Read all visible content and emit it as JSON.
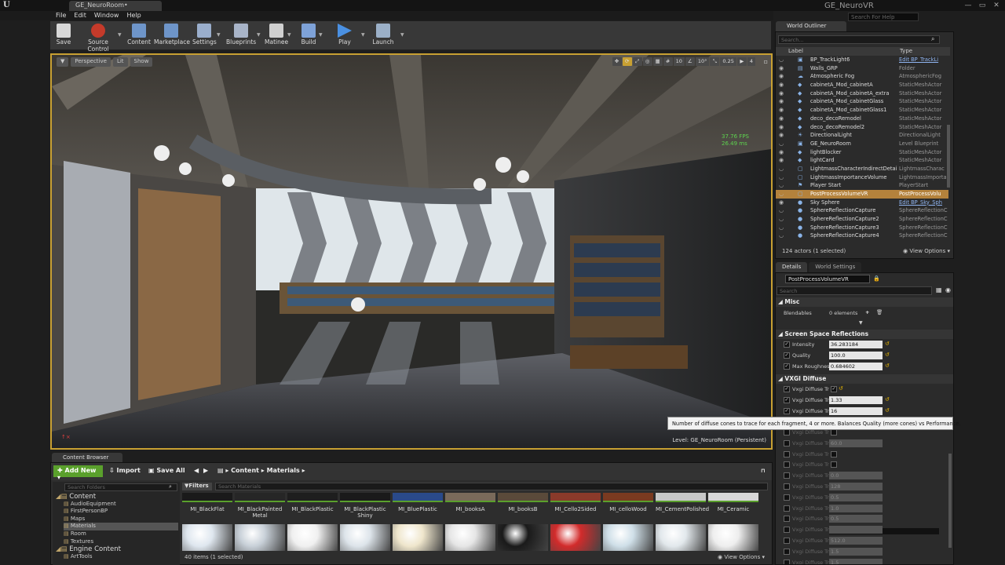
{
  "window": {
    "doc_tab": "GE_NeuroRoom•",
    "project": "GE_NeuroVR",
    "help_placeholder": "Search For Help"
  },
  "menu": [
    "File",
    "Edit",
    "Window",
    "Help"
  ],
  "toolbar": [
    {
      "label": "Save",
      "icon": "save-icon",
      "color": "#d8d8d8"
    },
    {
      "label": "Source Control",
      "icon": "source-control-icon",
      "color": "#c43a2a"
    },
    {
      "label": "Content",
      "icon": "content-icon",
      "color": "#6e95c9"
    },
    {
      "label": "Marketplace",
      "icon": "marketplace-icon",
      "color": "#6e95c9"
    },
    {
      "label": "Settings",
      "icon": "settings-icon",
      "color": "#9aaecc"
    },
    {
      "label": "Blueprints",
      "icon": "blueprints-icon",
      "color": "#a8b4c8"
    },
    {
      "label": "Matinee",
      "icon": "matinee-icon",
      "color": "#d0d0d0"
    },
    {
      "label": "Build",
      "icon": "build-icon",
      "color": "#7ea2d8"
    },
    {
      "label": "Play",
      "icon": "play-icon",
      "color": "#4a90e2"
    },
    {
      "label": "Launch",
      "icon": "launch-icon",
      "color": "#9bb0c8"
    }
  ],
  "viewport": {
    "perspective": "Perspective",
    "lit": "Lit",
    "show": "Show",
    "snap_grid": "10",
    "snap_angle": "10°",
    "snap_scale": "0.25",
    "cam_speed": "4",
    "fps": "37.76 FPS",
    "ms": "26.49 ms",
    "level_label": "Level:",
    "level_name": "GE_NeuroRoom (Persistent)"
  },
  "outliner": {
    "tab": "World Outliner",
    "search": "Search...",
    "col_label": "Label",
    "col_type": "Type",
    "rows": [
      {
        "label": "BP_TrackLight6",
        "type": "Edit BP_TrackLi",
        "link": true,
        "eye": false,
        "icon": "blueprint-icon"
      },
      {
        "label": "Walls_GRP",
        "type": "Folder",
        "eye": true,
        "icon": "folder-icon"
      },
      {
        "label": "Atmospheric Fog",
        "type": "AtmosphericFog",
        "eye": true,
        "icon": "fog-icon"
      },
      {
        "label": "cabinetA_Mod_cabinetA",
        "type": "StaticMeshActor",
        "eye": true,
        "icon": "mesh-icon"
      },
      {
        "label": "cabinetA_Mod_cabinetA_extra",
        "type": "StaticMeshActor",
        "eye": true,
        "icon": "mesh-icon"
      },
      {
        "label": "cabinetA_Mod_cabinetGlass",
        "type": "StaticMeshActor",
        "eye": true,
        "icon": "mesh-icon"
      },
      {
        "label": "cabinetA_Mod_cabinetGlass1",
        "type": "StaticMeshActor",
        "eye": true,
        "icon": "mesh-icon"
      },
      {
        "label": "deco_decoRemodel",
        "type": "StaticMeshActor",
        "eye": true,
        "icon": "mesh-icon"
      },
      {
        "label": "deco_decoRemodel2",
        "type": "StaticMeshActor",
        "eye": true,
        "icon": "mesh-icon"
      },
      {
        "label": "DirectionalLight",
        "type": "DirectionalLight",
        "eye": true,
        "icon": "sun-icon"
      },
      {
        "label": "GE_NeuroRoom",
        "type": "Level Blueprint",
        "eye": false,
        "icon": "blueprint-icon"
      },
      {
        "label": "lightBlocker",
        "type": "StaticMeshActor",
        "eye": true,
        "icon": "mesh-icon"
      },
      {
        "label": "lightCard",
        "type": "StaticMeshActor",
        "eye": true,
        "icon": "mesh-icon"
      },
      {
        "label": "LightmassCharacterIndirectDetailV",
        "type": "LightmassCharac",
        "eye": false,
        "icon": "volume-icon"
      },
      {
        "label": "LightmassImportanceVolume",
        "type": "LightmassImporta",
        "eye": false,
        "icon": "volume-icon"
      },
      {
        "label": "Player Start",
        "type": "PlayerStart",
        "eye": false,
        "icon": "player-icon"
      },
      {
        "label": "PostProcessVolumeVR",
        "type": "PostProcessVolu",
        "eye": false,
        "icon": "volume-icon",
        "sel": true
      },
      {
        "label": "Sky Sphere",
        "type": "Edit BP_Sky_Sph",
        "link": true,
        "eye": true,
        "icon": "sphere-icon"
      },
      {
        "label": "SphereReflectionCapture",
        "type": "SphereReflectionC",
        "eye": false,
        "icon": "sphere-icon"
      },
      {
        "label": "SphereReflectionCapture2",
        "type": "SphereReflectionC",
        "eye": false,
        "icon": "sphere-icon"
      },
      {
        "label": "SphereReflectionCapture3",
        "type": "SphereReflectionC",
        "eye": false,
        "icon": "sphere-icon"
      },
      {
        "label": "SphereReflectionCapture4",
        "type": "SphereReflectionC",
        "eye": false,
        "icon": "sphere-icon"
      }
    ],
    "count": "124 actors (1 selected)",
    "view_options": "View Options"
  },
  "details": {
    "tab": "Details",
    "tab2": "World Settings",
    "name": "PostProcessVolumeVR",
    "search": "Search",
    "misc": "Misc",
    "blendables_label": "Blendables",
    "blendables_value": "0 elements",
    "ssr": "Screen Space Reflections",
    "ssr_rows": [
      {
        "name": "Intensity",
        "value": "36.283184"
      },
      {
        "name": "Quality",
        "value": "100.0"
      },
      {
        "name": "Max Roughness",
        "value": "0.684602"
      }
    ],
    "vxgi": "VXGI Diffuse",
    "vxgi_rows": [
      {
        "name": "Vxgi Diffuse Tr",
        "value": "✓",
        "check": true
      },
      {
        "name": "Vxgi Diffuse Tr",
        "value": "1.33"
      },
      {
        "name": "Vxgi Diffuse Tr",
        "value": "16"
      }
    ],
    "dim_rows": [
      {
        "name": "Vxgi Diffuse Tr",
        "value": "",
        "cb": true
      },
      {
        "name": "Vxgi Diffuse Tr",
        "value": "60.0"
      },
      {
        "name": "Vxgi Diffuse Tr",
        "value": "",
        "cb": true
      },
      {
        "name": "Vxgi Diffuse Tr",
        "value": "",
        "cb": true
      },
      {
        "name": "Vxgi Diffuse Tr",
        "value": "0.0"
      },
      {
        "name": "Vxgi Diffuse Tr",
        "value": "128"
      },
      {
        "name": "Vxgi Diffuse Tr",
        "value": "0.5"
      },
      {
        "name": "Vxgi Diffuse Tr",
        "value": "1.0"
      },
      {
        "name": "Vxgi Diffuse Tr",
        "value": "0.5"
      },
      {
        "name": "Vxgi Diffuse Tr",
        "value": ""
      },
      {
        "name": "Vxgi Diffuse Tr",
        "value": "512.0"
      },
      {
        "name": "Vxgi Diffuse Tr",
        "value": "1.5"
      },
      {
        "name": "Vxgi Diffuse Tr",
        "value": "1.5"
      }
    ],
    "tooltip": "Number of diffuse cones to trace for each fragment, 4 or more. Balances Quality (more cones) vs Performance."
  },
  "content_browser": {
    "tab": "Content Browser",
    "add_new": "Add New",
    "import": "Import",
    "save_all": "Save All",
    "path": [
      "Content",
      "Materials"
    ],
    "search_folders": "Search Folders",
    "filters": "Filters",
    "search_materials": "Search Materials",
    "tree": [
      {
        "label": "Content",
        "level": 0,
        "big": true
      },
      {
        "label": "AudioEquipment",
        "level": 1
      },
      {
        "label": "FirstPersonBP",
        "level": 1
      },
      {
        "label": "Maps",
        "level": 1
      },
      {
        "label": "Materials",
        "level": 1,
        "sel": true
      },
      {
        "label": "Room",
        "level": 1
      },
      {
        "label": "Textures",
        "level": 1
      },
      {
        "label": "Engine Content",
        "level": 0,
        "big": true
      },
      {
        "label": "ArtTools",
        "level": 1
      }
    ],
    "assets": [
      "MI_BlackFlat",
      "MI_BlackPainted Metal",
      "MI_BlackPlastic",
      "MI_BlackPlastic Shiny",
      "MI_BluePlastic",
      "MI_booksA",
      "MI_booksB",
      "MI_Cello2Sided",
      "MI_celloWood",
      "MI_CementPolished",
      "MI_Ceramic"
    ],
    "thumb_colors_top": [
      "#1a1a1a",
      "#262626",
      "#1e1e1e",
      "#1a1a1a",
      "#2a4a8a",
      "#7a6a5a",
      "#5a4a3a",
      "#8a3a2a",
      "#7a3a20",
      "#c8c8c8",
      "#d8d8d8"
    ],
    "thumb_colors_bottom": [
      "#dfe7ef",
      "#c8d0d8",
      "#f0f0f0",
      "#dde4ea",
      "#efe6cc",
      "#e6e6e6",
      "#1a1a1a",
      "#d22b2b",
      "#cfdfe8",
      "#e2e8ec",
      "#eeeeee"
    ],
    "count": "40 items (1 selected)",
    "view_options": "View Options"
  },
  "colors": {
    "accent": "#c8a032",
    "selection": "#b4823c",
    "add_new": "#5aa02c",
    "fps": "#5ed34f"
  }
}
